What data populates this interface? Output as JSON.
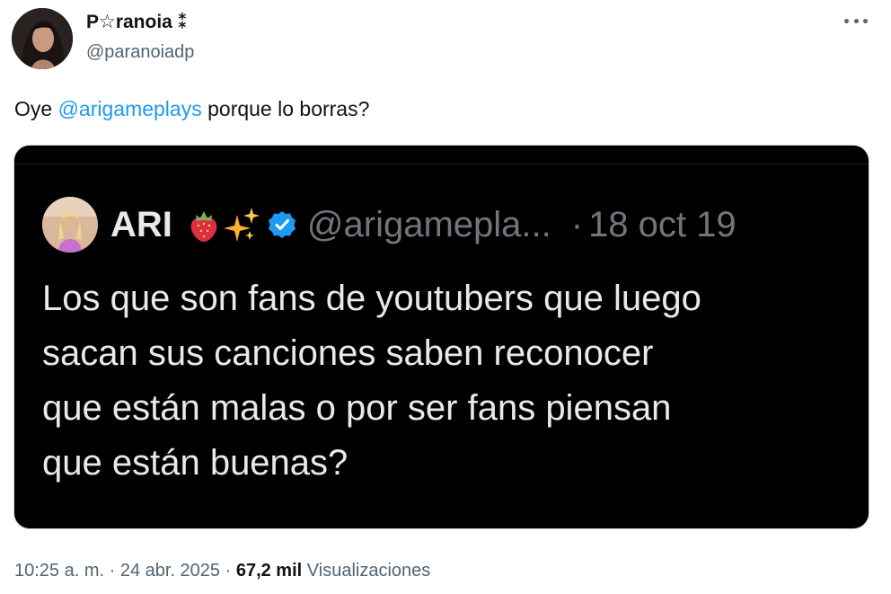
{
  "author": {
    "display_name": "P☆ranoia ⁑",
    "handle": "@paranoiadp"
  },
  "tweet": {
    "text_prefix": "Oye ",
    "mention": "@arigameplays",
    "text_suffix": " porque lo borras?"
  },
  "quote": {
    "name": "ARI",
    "emojis": [
      "strawberry-emoji",
      "sparkles-emoji"
    ],
    "verified_icon": "verified-badge-icon",
    "handle": "@arigamepla...",
    "separator": "·",
    "date": "18 oct 19",
    "body": "Los que son fans de youtubers que luego\nsacan sus canciones saben reconocer\nque están malas o por ser fans piensan\nque están buenas?"
  },
  "meta": {
    "timestamp": "10:25 a. m. · 24 abr. 2025 · ",
    "views_count": "67,2 mil",
    "views_label": " Visualizaciones"
  },
  "colors": {
    "mention": "#1d9bf0",
    "secondary_text": "#536471",
    "quote_background": "#000000",
    "quote_text": "#e7e9ea",
    "verified": "#1d9bf0"
  },
  "icons": {
    "more": "more-dots-icon"
  }
}
